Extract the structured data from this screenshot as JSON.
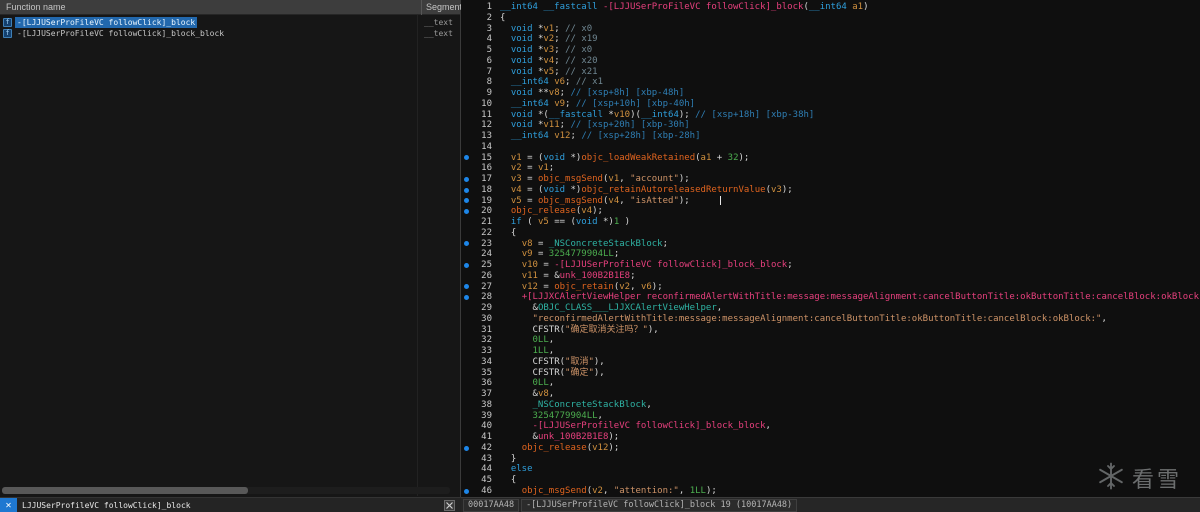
{
  "functions_panel": {
    "header": {
      "name_col": "Function name",
      "segment_col": "Segment"
    },
    "icon_label": "f",
    "items": [
      {
        "name": "-[LJJUSerProFileVC followClick]_block",
        "segment": "__text",
        "selected": true
      },
      {
        "name": "-[LJJUSerProFileVC followClick]_block_block",
        "segment": "__text",
        "selected": false
      }
    ],
    "filter": {
      "close_label": "✕",
      "text": "LJJUSerProfileVC followClick]_block"
    }
  },
  "status_bar": {
    "address": "00017AA48",
    "location": "-[LJJUSerProfileVC followClick]_block 19 (10017AA48)"
  },
  "watermark": {
    "icon": "snowflake-icon",
    "text": "看雪"
  },
  "colors": {
    "keyword": "#2f9fdc",
    "plain": "#d6d6d6",
    "variable": "#d1913f",
    "api_call": "#e0641f",
    "string": "#cf9468",
    "number": "#4cae4f",
    "method_name": "#e8407e",
    "dummy_name": "#e8407e",
    "comment": "#6f8691",
    "stack_comment": "#2f7fb5",
    "block_symbol": "#2fb3a4",
    "selection": "#2268ad",
    "breakpoint": "#1d86e8"
  },
  "code": {
    "caret_line": 19,
    "breakpoint_lines": [
      15,
      17,
      18,
      19,
      20,
      23,
      25,
      27,
      28,
      42,
      46
    ],
    "lines": [
      {
        "num": 1,
        "tokens": [
          [
            "k",
            "__int64 __fastcall "
          ],
          [
            "m",
            "-[LJJUSerProFileVC followClick]_block"
          ],
          [
            "p",
            "("
          ],
          [
            "k",
            "__int64"
          ],
          [
            "p",
            " "
          ],
          [
            "v",
            "a1"
          ],
          [
            "p",
            ")"
          ]
        ]
      },
      {
        "num": 2,
        "tokens": [
          [
            "p",
            "{"
          ]
        ]
      },
      {
        "num": 3,
        "tokens": [
          [
            "p",
            "  "
          ],
          [
            "k",
            "void"
          ],
          [
            "p",
            " *"
          ],
          [
            "v",
            "v1"
          ],
          [
            "p",
            "; "
          ],
          [
            "c",
            "// x0"
          ]
        ]
      },
      {
        "num": 4,
        "tokens": [
          [
            "p",
            "  "
          ],
          [
            "k",
            "void"
          ],
          [
            "p",
            " *"
          ],
          [
            "v",
            "v2"
          ],
          [
            "p",
            "; "
          ],
          [
            "c",
            "// x19"
          ]
        ]
      },
      {
        "num": 5,
        "tokens": [
          [
            "p",
            "  "
          ],
          [
            "k",
            "void"
          ],
          [
            "p",
            " *"
          ],
          [
            "v",
            "v3"
          ],
          [
            "p",
            "; "
          ],
          [
            "c",
            "// x0"
          ]
        ]
      },
      {
        "num": 6,
        "tokens": [
          [
            "p",
            "  "
          ],
          [
            "k",
            "void"
          ],
          [
            "p",
            " *"
          ],
          [
            "v",
            "v4"
          ],
          [
            "p",
            "; "
          ],
          [
            "c",
            "// x20"
          ]
        ]
      },
      {
        "num": 7,
        "tokens": [
          [
            "p",
            "  "
          ],
          [
            "k",
            "void"
          ],
          [
            "p",
            " *"
          ],
          [
            "v",
            "v5"
          ],
          [
            "p",
            "; "
          ],
          [
            "c",
            "// x21"
          ]
        ]
      },
      {
        "num": 8,
        "tokens": [
          [
            "p",
            "  "
          ],
          [
            "k",
            "__int64"
          ],
          [
            "p",
            " "
          ],
          [
            "v",
            "v6"
          ],
          [
            "p",
            "; "
          ],
          [
            "c",
            "// x1"
          ]
        ]
      },
      {
        "num": 9,
        "tokens": [
          [
            "p",
            "  "
          ],
          [
            "k",
            "void"
          ],
          [
            "p",
            " **"
          ],
          [
            "v",
            "v8"
          ],
          [
            "p",
            "; "
          ],
          [
            "sc",
            "// [xsp+8h] [xbp-48h]"
          ]
        ]
      },
      {
        "num": 10,
        "tokens": [
          [
            "p",
            "  "
          ],
          [
            "k",
            "__int64"
          ],
          [
            "p",
            " "
          ],
          [
            "v",
            "v9"
          ],
          [
            "p",
            "; "
          ],
          [
            "sc",
            "// [xsp+10h] [xbp-40h]"
          ]
        ]
      },
      {
        "num": 11,
        "tokens": [
          [
            "p",
            "  "
          ],
          [
            "k",
            "void"
          ],
          [
            "p",
            " *("
          ],
          [
            "k",
            "__fastcall"
          ],
          [
            "p",
            " *"
          ],
          [
            "v",
            "v10"
          ],
          [
            "p",
            ")("
          ],
          [
            "k",
            "__int64"
          ],
          [
            "p",
            "); "
          ],
          [
            "sc",
            "// [xsp+18h] [xbp-38h]"
          ]
        ]
      },
      {
        "num": 12,
        "tokens": [
          [
            "p",
            "  "
          ],
          [
            "k",
            "void"
          ],
          [
            "p",
            " *"
          ],
          [
            "v",
            "v11"
          ],
          [
            "p",
            "; "
          ],
          [
            "sc",
            "// [xsp+20h] [xbp-30h]"
          ]
        ]
      },
      {
        "num": 13,
        "tokens": [
          [
            "p",
            "  "
          ],
          [
            "k",
            "__int64"
          ],
          [
            "p",
            " "
          ],
          [
            "v",
            "v12"
          ],
          [
            "p",
            "; "
          ],
          [
            "sc",
            "// [xsp+28h] [xbp-28h]"
          ]
        ]
      },
      {
        "num": 14,
        "tokens": []
      },
      {
        "num": 15,
        "tokens": [
          [
            "p",
            "  "
          ],
          [
            "v",
            "v1"
          ],
          [
            "p",
            " = ("
          ],
          [
            "k",
            "void"
          ],
          [
            "p",
            " *)"
          ],
          [
            "f",
            "objc_loadWeakRetained"
          ],
          [
            "p",
            "("
          ],
          [
            "v",
            "a1"
          ],
          [
            "p",
            " + "
          ],
          [
            "num",
            "32"
          ],
          [
            "p",
            ");"
          ]
        ]
      },
      {
        "num": 16,
        "tokens": [
          [
            "p",
            "  "
          ],
          [
            "v",
            "v2"
          ],
          [
            "p",
            " = "
          ],
          [
            "v",
            "v1"
          ],
          [
            "p",
            ";"
          ]
        ]
      },
      {
        "num": 17,
        "tokens": [
          [
            "p",
            "  "
          ],
          [
            "v",
            "v3"
          ],
          [
            "p",
            " = "
          ],
          [
            "f",
            "objc_msgSend"
          ],
          [
            "p",
            "("
          ],
          [
            "v",
            "v1"
          ],
          [
            "p",
            ", "
          ],
          [
            "s",
            "\"account\""
          ],
          [
            "p",
            ");"
          ]
        ]
      },
      {
        "num": 18,
        "tokens": [
          [
            "p",
            "  "
          ],
          [
            "v",
            "v4"
          ],
          [
            "p",
            " = ("
          ],
          [
            "k",
            "void"
          ],
          [
            "p",
            " *)"
          ],
          [
            "f",
            "objc_retainAutoreleasedReturnValue"
          ],
          [
            "p",
            "("
          ],
          [
            "v",
            "v3"
          ],
          [
            "p",
            ");"
          ]
        ]
      },
      {
        "num": 19,
        "tokens": [
          [
            "p",
            "  "
          ],
          [
            "v",
            "v5"
          ],
          [
            "p",
            " = "
          ],
          [
            "f",
            "objc_msgSend"
          ],
          [
            "p",
            "("
          ],
          [
            "v",
            "v4"
          ],
          [
            "p",
            ", "
          ],
          [
            "s",
            "\"isAtted\""
          ],
          [
            "p",
            ");"
          ]
        ]
      },
      {
        "num": 20,
        "tokens": [
          [
            "p",
            "  "
          ],
          [
            "f",
            "objc_release"
          ],
          [
            "p",
            "("
          ],
          [
            "v",
            "v4"
          ],
          [
            "p",
            ");"
          ]
        ]
      },
      {
        "num": 21,
        "tokens": [
          [
            "p",
            "  "
          ],
          [
            "k",
            "if"
          ],
          [
            "p",
            " ( "
          ],
          [
            "v",
            "v5"
          ],
          [
            "p",
            " == ("
          ],
          [
            "k",
            "void"
          ],
          [
            "p",
            " *)"
          ],
          [
            "num",
            "1"
          ],
          [
            "p",
            " )"
          ]
        ]
      },
      {
        "num": 22,
        "tokens": [
          [
            "p",
            "  {"
          ]
        ]
      },
      {
        "num": 23,
        "tokens": [
          [
            "p",
            "    "
          ],
          [
            "v",
            "v8"
          ],
          [
            "p",
            " = "
          ],
          [
            "t",
            "_NSConcreteStackBlock"
          ],
          [
            "p",
            ";"
          ]
        ]
      },
      {
        "num": 24,
        "tokens": [
          [
            "p",
            "    "
          ],
          [
            "v",
            "v9"
          ],
          [
            "p",
            " = "
          ],
          [
            "num",
            "3254779904LL"
          ],
          [
            "p",
            ";"
          ]
        ]
      },
      {
        "num": 25,
        "tokens": [
          [
            "p",
            "    "
          ],
          [
            "v",
            "v10"
          ],
          [
            "p",
            " = "
          ],
          [
            "m",
            "-[LJJUSerProfileVC followClick]_block_block"
          ],
          [
            "p",
            ";"
          ]
        ]
      },
      {
        "num": 26,
        "tokens": [
          [
            "p",
            "    "
          ],
          [
            "v",
            "v11"
          ],
          [
            "p",
            " = &"
          ],
          [
            "d",
            "unk_100B2B1E8"
          ],
          [
            "p",
            ";"
          ]
        ]
      },
      {
        "num": 27,
        "tokens": [
          [
            "p",
            "    "
          ],
          [
            "v",
            "v12"
          ],
          [
            "p",
            " = "
          ],
          [
            "f",
            "objc_retain"
          ],
          [
            "p",
            "("
          ],
          [
            "v",
            "v2"
          ],
          [
            "p",
            ", "
          ],
          [
            "v",
            "v6"
          ],
          [
            "p",
            ");"
          ]
        ]
      },
      {
        "num": 28,
        "tokens": [
          [
            "p",
            "    "
          ],
          [
            "m",
            "+[LJJXCAlertViewHelper reconfirmedAlertWithTitle:message:messageAlignment:cancelButtonTitle:okButtonTitle:cancelBlock:okBlock:]"
          ],
          [
            "p",
            "("
          ]
        ]
      },
      {
        "num": 29,
        "tokens": [
          [
            "p",
            "      &"
          ],
          [
            "t",
            "OBJC_CLASS___LJJXCAlertViewHelper"
          ],
          [
            "p",
            ","
          ]
        ]
      },
      {
        "num": 30,
        "tokens": [
          [
            "p",
            "      "
          ],
          [
            "s",
            "\"reconfirmedAlertWithTitle:message:messageAlignment:cancelButtonTitle:okButtonTitle:cancelBlock:okBlock:\""
          ],
          [
            "p",
            ","
          ]
        ]
      },
      {
        "num": 31,
        "tokens": [
          [
            "p",
            "      "
          ],
          [
            "w",
            "CFSTR"
          ],
          [
            "p",
            "("
          ],
          [
            "s",
            "\"确定取消关注吗？\""
          ],
          [
            "p",
            "),"
          ]
        ]
      },
      {
        "num": 32,
        "tokens": [
          [
            "p",
            "      "
          ],
          [
            "num",
            "0LL"
          ],
          [
            "p",
            ","
          ]
        ]
      },
      {
        "num": 33,
        "tokens": [
          [
            "p",
            "      "
          ],
          [
            "num",
            "1LL"
          ],
          [
            "p",
            ","
          ]
        ]
      },
      {
        "num": 34,
        "tokens": [
          [
            "p",
            "      "
          ],
          [
            "w",
            "CFSTR"
          ],
          [
            "p",
            "("
          ],
          [
            "s",
            "\"取消\""
          ],
          [
            "p",
            "),"
          ]
        ]
      },
      {
        "num": 35,
        "tokens": [
          [
            "p",
            "      "
          ],
          [
            "w",
            "CFSTR"
          ],
          [
            "p",
            "("
          ],
          [
            "s",
            "\"确定\""
          ],
          [
            "p",
            "),"
          ]
        ]
      },
      {
        "num": 36,
        "tokens": [
          [
            "p",
            "      "
          ],
          [
            "num",
            "0LL"
          ],
          [
            "p",
            ","
          ]
        ]
      },
      {
        "num": 37,
        "tokens": [
          [
            "p",
            "      &"
          ],
          [
            "v",
            "v8"
          ],
          [
            "p",
            ","
          ]
        ]
      },
      {
        "num": 38,
        "tokens": [
          [
            "p",
            "      "
          ],
          [
            "t",
            "_NSConcreteStackBlock"
          ],
          [
            "p",
            ","
          ]
        ]
      },
      {
        "num": 39,
        "tokens": [
          [
            "p",
            "      "
          ],
          [
            "num",
            "3254779904LL"
          ],
          [
            "p",
            ","
          ]
        ]
      },
      {
        "num": 40,
        "tokens": [
          [
            "p",
            "      "
          ],
          [
            "m",
            "-[LJJUSerProfileVC followClick]_block_block"
          ],
          [
            "p",
            ","
          ]
        ]
      },
      {
        "num": 41,
        "tokens": [
          [
            "p",
            "      &"
          ],
          [
            "d",
            "unk_100B2B1E8"
          ],
          [
            "p",
            ");"
          ]
        ]
      },
      {
        "num": 42,
        "tokens": [
          [
            "p",
            "    "
          ],
          [
            "f",
            "objc_release"
          ],
          [
            "p",
            "("
          ],
          [
            "v",
            "v12"
          ],
          [
            "p",
            ");"
          ]
        ]
      },
      {
        "num": 43,
        "tokens": [
          [
            "p",
            "  }"
          ]
        ]
      },
      {
        "num": 44,
        "tokens": [
          [
            "p",
            "  "
          ],
          [
            "k",
            "else"
          ]
        ]
      },
      {
        "num": 45,
        "tokens": [
          [
            "p",
            "  {"
          ]
        ]
      },
      {
        "num": 46,
        "tokens": [
          [
            "p",
            "    "
          ],
          [
            "f",
            "objc_msgSend"
          ],
          [
            "p",
            "("
          ],
          [
            "v",
            "v2"
          ],
          [
            "p",
            ", "
          ],
          [
            "s",
            "\"attention:\""
          ],
          [
            "p",
            ", "
          ],
          [
            "num",
            "1LL"
          ],
          [
            "p",
            ");"
          ]
        ]
      }
    ]
  }
}
